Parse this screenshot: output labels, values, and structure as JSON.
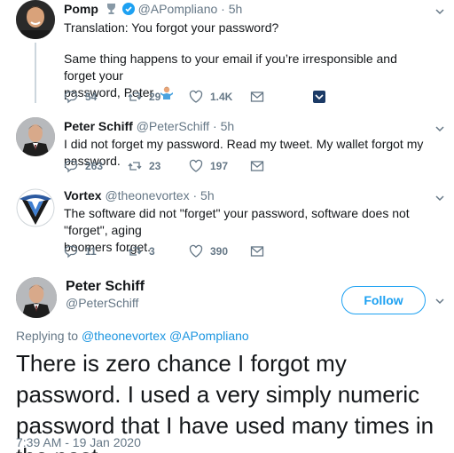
{
  "tweets": [
    {
      "name": "Pomp",
      "handle": "@APompliano",
      "time": "5h",
      "text_line1": "Translation: You forgot your password?",
      "text_line2": "Same thing happens to your email if you’re irresponsible and forget your",
      "text_line3": "password, Peter",
      "replies": "54",
      "retweets": "29",
      "likes": "1.4K"
    },
    {
      "name": "Peter Schiff",
      "handle": "@PeterSchiff",
      "time": "5h",
      "text_line1": "I did not forget my password.  Read my tweet.  My wallet forgot my password.",
      "replies": "263",
      "retweets": "23",
      "likes": "197"
    },
    {
      "name": "Vortex",
      "handle": "@theonevortex",
      "time": "5h",
      "text_line1": "The software did not \"forget\" your password, software does not \"forget\", aging",
      "text_line2": "boomers forget.",
      "replies": "11",
      "retweets": "3",
      "likes": "390"
    }
  ],
  "main": {
    "name": "Peter Schiff",
    "handle": "@PeterSchiff",
    "follow_label": "Follow",
    "replying_prefix": "Replying to",
    "replying_to_1": "@theonevortex",
    "replying_to_2": "@APompliano",
    "text": "There is zero chance I forgot my password.  I used a very simply numeric password that I have used many times in the past.",
    "timestamp": "7:39 AM - 19 Jan 2020"
  },
  "colors": {
    "brand_blue": "#1da1f2",
    "text": "#14171a",
    "secondary": "#657786"
  }
}
